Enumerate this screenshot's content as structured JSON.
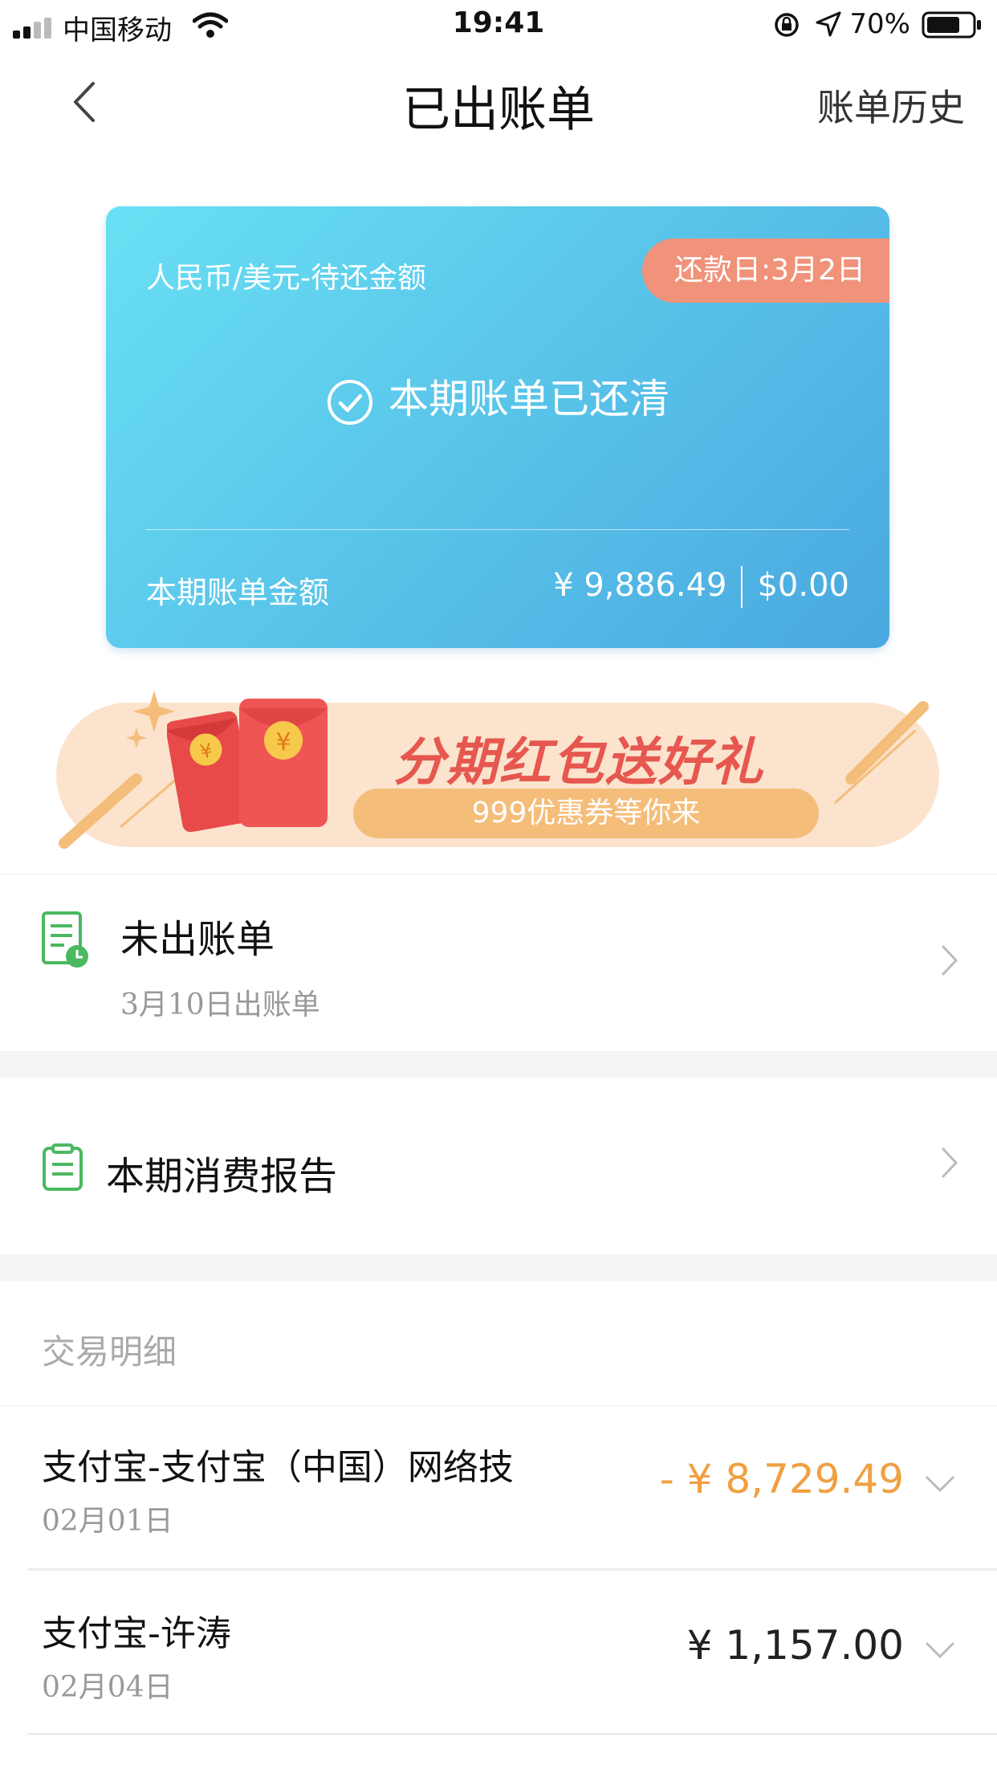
{
  "status_bar": {
    "carrier": "中国移动",
    "time": "19:41",
    "battery": "70%"
  },
  "nav": {
    "title": "已出账单",
    "right_link": "账单历史"
  },
  "card": {
    "label": "人民币/美元-待还金额",
    "due_date": "还款日:3月2日",
    "status": "本期账单已还清",
    "amount_label": "本期账单金额",
    "amount_cny": "¥ 9,886.49",
    "amount_usd": "$0.00",
    "colors": {
      "gradient_start": "#69e0f4",
      "gradient_end": "#4aa8e0",
      "pill": "#f0937a"
    }
  },
  "banner": {
    "title": "分期红包送好礼",
    "subtitle": "999优惠券等你来",
    "envelope_symbol": "¥"
  },
  "unbilled": {
    "title": "未出账单",
    "subtitle": "3月10日出账单"
  },
  "report": {
    "title": "本期消费报告"
  },
  "details": {
    "title": "交易明细",
    "transactions": [
      {
        "name": "支付宝-支付宝（中国）网络技",
        "date": "02月01日",
        "amount": "- ¥ 8,729.49",
        "color": "#f0a040"
      },
      {
        "name": "支付宝-许涛",
        "date": "02月04日",
        "amount": "¥ 1,157.00",
        "color": "#222222"
      }
    ]
  },
  "accent": {
    "green": "#4cb860",
    "orange": "#f0a040"
  }
}
